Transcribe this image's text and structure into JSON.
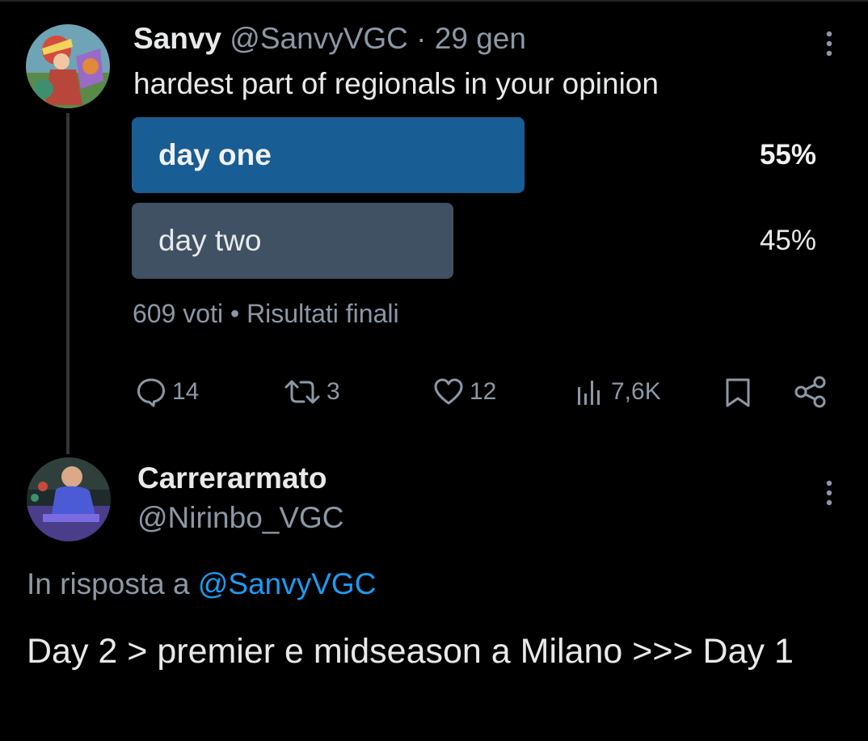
{
  "tweet": {
    "author_name": "Sanvy",
    "author_handle": "@SanvyVGC",
    "separator": "·",
    "date": "29 gen",
    "text": "hardest part of regionals in your opinion",
    "poll": {
      "options": [
        {
          "label": "day one",
          "percent_text": "55%",
          "percent_value": 55,
          "bar_color": "#185d93"
        },
        {
          "label": "day two",
          "percent_text": "45%",
          "percent_value": 45,
          "bar_color": "#3f5163"
        }
      ],
      "votes": "609 voti",
      "separator": "•",
      "status": "Risultati finali"
    },
    "actions": {
      "replies": "14",
      "retweets": "3",
      "likes": "12",
      "views": "7,6K"
    }
  },
  "reply": {
    "author_name": "Carrerarmato",
    "author_handle": "@Nirinbo_VGC",
    "in_reply_prefix": "In risposta a",
    "in_reply_handle": "@SanvyVGC",
    "text": "Day 2 > premier e midseason a Milano >>> Day 1"
  },
  "icons": {
    "reply": "comment-icon",
    "retweet": "retweet-icon",
    "like": "heart-icon",
    "views": "analytics-icon",
    "bookmark": "bookmark-icon",
    "share": "share-icon",
    "more": "more-vertical-icon"
  },
  "colors": {
    "background": "#000000",
    "text": "#e7e9ea",
    "secondary_text": "#8b98a5",
    "mention": "#1d9bf0",
    "winning_bar": "#185d93",
    "other_bar": "#3f5163"
  }
}
